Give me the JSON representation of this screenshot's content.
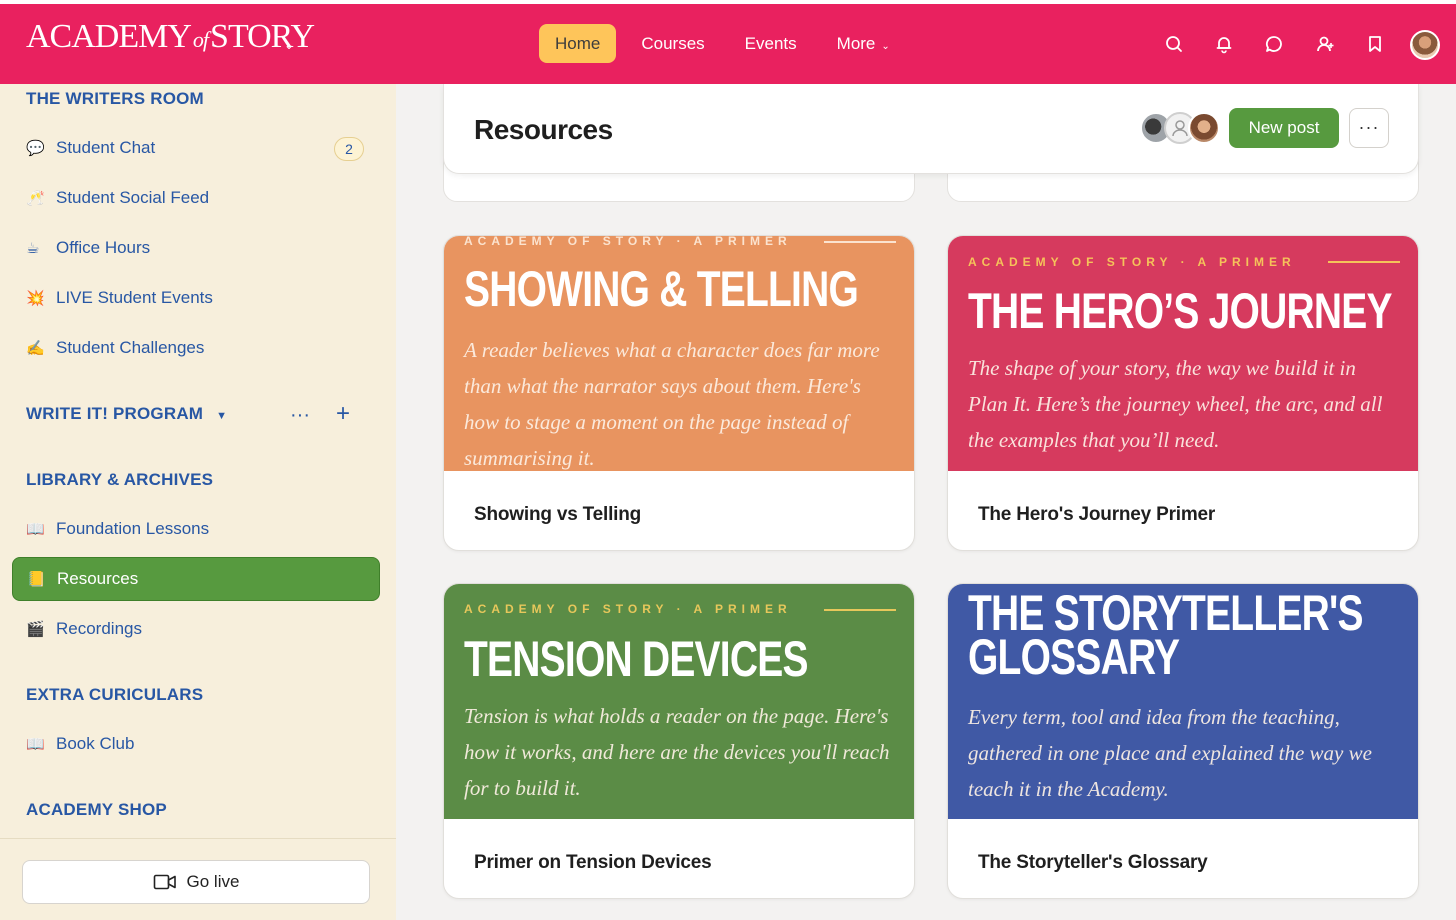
{
  "brand": {
    "logo_left": "ACADEMY",
    "logo_of": "of",
    "logo_right": "STORY"
  },
  "nav": {
    "items": [
      {
        "label": "Home",
        "active": true
      },
      {
        "label": "Courses"
      },
      {
        "label": "Events"
      },
      {
        "label": "More"
      }
    ]
  },
  "sidebar": {
    "sections": {
      "writers_room": "THE WRITERS ROOM",
      "write_it": "WRITE IT! PROGRAM",
      "library": "LIBRARY & ARCHIVES",
      "extra": "EXTRA CURICULARS",
      "shop": "ACADEMY SHOP"
    },
    "items": [
      {
        "emoji": "💬",
        "label": "Student Chat",
        "badge": "2"
      },
      {
        "emoji": "🥂",
        "label": "Student Social Feed"
      },
      {
        "emoji": "☕",
        "label": "Office Hours"
      },
      {
        "emoji": "💥",
        "label": "LIVE Student Events"
      },
      {
        "emoji": "✍️",
        "label": "Student Challenges"
      },
      {
        "emoji": "📖",
        "label": "Foundation Lessons"
      },
      {
        "emoji": "📒",
        "label": "Resources"
      },
      {
        "emoji": "🎬",
        "label": "Recordings"
      },
      {
        "emoji": "📖",
        "label": "Book Club"
      }
    ],
    "go_live": "Go live"
  },
  "header": {
    "title": "Resources",
    "new_post": "New post",
    "more": "···"
  },
  "cards": [
    {
      "kicker": "ACADEMY OF STORY · A PRIMER",
      "banner_title": "SHOWING & TELLING",
      "description": "A reader believes what a character does far more than what the narrator says about them. Here's how to stage a moment on the page instead of summarising it.",
      "label": "Showing vs Telling",
      "color": "#e89460",
      "kicker_color": "#fbe3cf"
    },
    {
      "kicker": "ACADEMY OF STORY · A PRIMER",
      "banner_title": "THE HERO’S JOURNEY",
      "description": "The shape of your story, the way we build it in Plan It. Here’s the journey wheel, the arc, and all the examples that you’ll need.",
      "label": "The Hero's Journey Primer",
      "color": "#d63a5e",
      "kicker_color": "#f5c35a"
    },
    {
      "kicker": "ACADEMY OF STORY · A PRIMER",
      "banner_title": "TENSION DEVICES",
      "description": "Tension is what holds a reader on the page. Here's how it works, and here are the devices you'll reach for to build it.",
      "label": "Primer on Tension Devices",
      "color": "#5b8c46",
      "kicker_color": "#e7c75b"
    },
    {
      "banner_title_line1": "THE STORYTELLER'S",
      "banner_title_line2": "GLOSSARY",
      "description": "Every term, tool and idea from the teaching, gathered in one place and explained the way we teach it in the Academy.",
      "label": "The Storyteller's Glossary",
      "color": "#4059a5"
    }
  ]
}
